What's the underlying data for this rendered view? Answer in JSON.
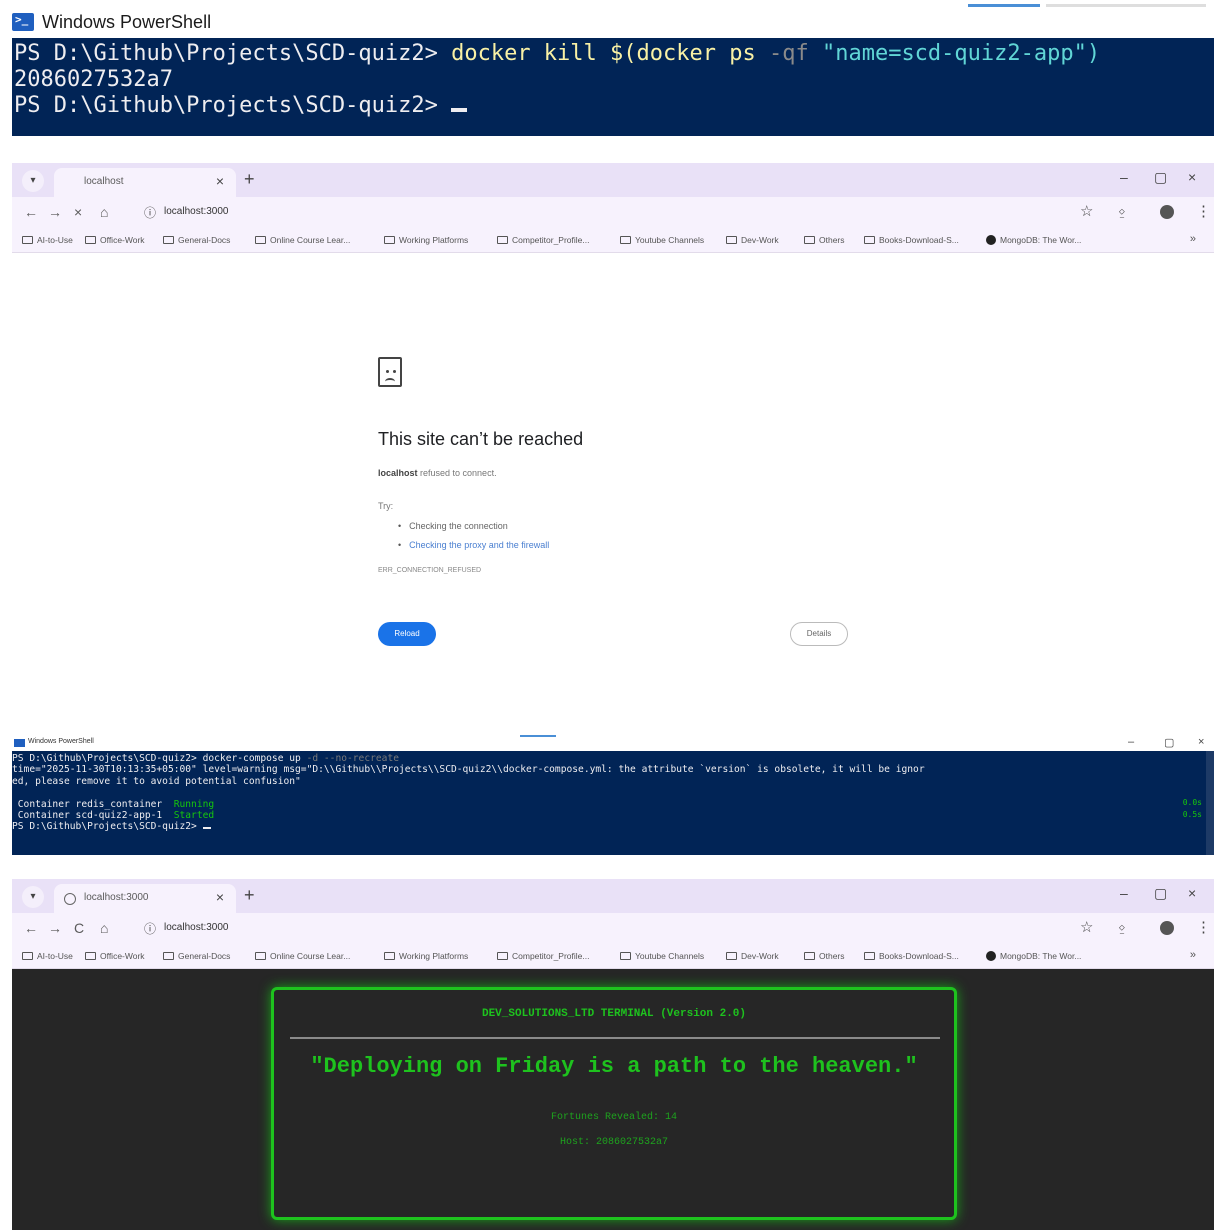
{
  "powershell_top": {
    "title": "Windows PowerShell",
    "prompt": "PS D:\\Github\\Projects\\SCD-quiz2> ",
    "command": "docker kill $(docker ps",
    "flag": " -qf ",
    "arg": "\"name=scd-quiz2-app\")",
    "output": "2086027532a7",
    "prompt2": "PS D:\\Github\\Projects\\SCD-quiz2> "
  },
  "browser_error": {
    "tab_title": "localhost",
    "reload_icon": "×",
    "url": "localhost:3000",
    "bookmarks": [
      "AI-to-Use",
      "Office-Work",
      "General-Docs",
      "Online Course Lear...",
      "Working Platforms",
      "Competitor_Profile...",
      "Youtube Channels",
      "Dev-Work",
      "Others",
      "Books-Download-S...",
      "MongoDB: The Wor..."
    ],
    "error": {
      "icon": "sad-page-icon",
      "title": "This site can’t be reached",
      "host": "localhost",
      "message": " refused to connect.",
      "try_label": "Try:",
      "suggestions": [
        "Checking the connection",
        "Checking the proxy and the firewall"
      ],
      "code": "ERR_CONNECTION_REFUSED",
      "reload_label": "Reload",
      "details_label": "Details"
    }
  },
  "powershell_mid": {
    "title": "Windows PowerShell",
    "line1_prompt": "PS D:\\Github\\Projects\\SCD-quiz2> ",
    "line1_cmd": "docker-compose up ",
    "line1_flags": "-d --no-recreate",
    "line2": "time=\"2025-11-30T10:13:35+05:00\" level=warning msg=\"D:\\\\Github\\\\Projects\\\\SCD-quiz2\\\\docker-compose.yml: the attribute `version` is obsolete, it will be ignor",
    "line3": "ed, please remove it to avoid potential confusion\"",
    "containers": [
      {
        "name": "Container redis_container  ",
        "status": "Running",
        "time": "0.0s"
      },
      {
        "name": "Container scd-quiz2-app-1  ",
        "status": "Started",
        "time": "0.5s"
      }
    ],
    "prompt_end": "PS D:\\Github\\Projects\\SCD-quiz2> "
  },
  "browser_app": {
    "tab_title": "localhost:3000",
    "reload_icon": "C",
    "url": "localhost:3000",
    "app": {
      "header": "DEV_SOLUTIONS_LTD TERMINAL (Version 2.0)",
      "quote": "\"Deploying on Friday is a path to the heaven.\"",
      "fortunes_line": "Fortunes Revealed: 14",
      "host_line": "Host: 2086027532a7"
    }
  },
  "colors": {
    "ps_background": "#012456",
    "terminal_green": "#1ec21e",
    "chrome_tab_bg": "#e9e1f7",
    "reload_blue": "#1a73e8"
  }
}
